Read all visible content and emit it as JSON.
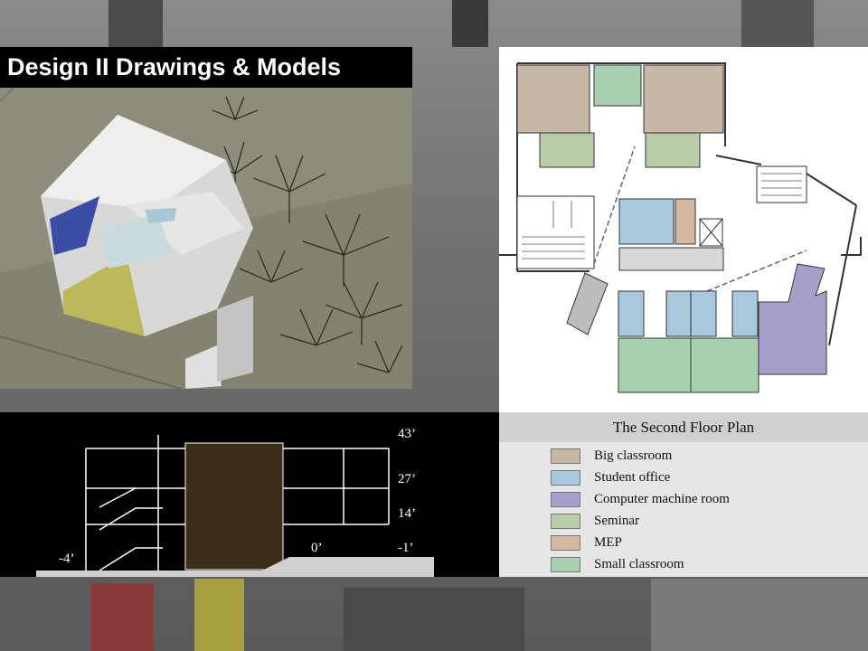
{
  "slide": {
    "title": "Design II Drawings & Models"
  },
  "floor_plan": {
    "title": "The Second Floor Plan",
    "colors": {
      "big_classroom": "#c8b6a6",
      "student_office": "#a8c8dc",
      "computer_room": "#a8a0cc",
      "seminar": "#b8cca8",
      "mep": "#d4b8a0",
      "small_classroom": "#a8d0b0"
    }
  },
  "legend": {
    "items": [
      {
        "label": "Big classroom",
        "color": "#c8b6a6"
      },
      {
        "label": "Student office",
        "color": "#a8c8dc"
      },
      {
        "label": "Computer machine room",
        "color": "#a8a0cc"
      },
      {
        "label": "Seminar",
        "color": "#b8cca8"
      },
      {
        "label": "MEP",
        "color": "#d4b8a0"
      },
      {
        "label": "Small classroom",
        "color": "#a8d0b0"
      }
    ]
  },
  "section": {
    "elevations": {
      "e43": "43’",
      "e27": "27’",
      "e14": "14’",
      "em1": "-1’",
      "e0": "0’",
      "em4": "-4’"
    }
  }
}
